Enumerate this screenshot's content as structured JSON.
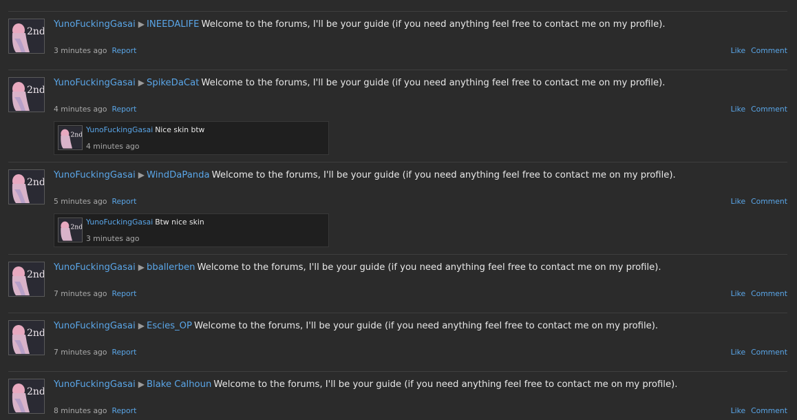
{
  "posts": [
    {
      "author": "YunoFuckingGasai",
      "target": "INEEDALIFE",
      "message": "Welcome to the forums, I'll be your guide (if you need anything feel free to contact me on my profile).",
      "time": "3 minutes ago",
      "report": "Report",
      "like": "Like",
      "comment": "Comment"
    },
    {
      "author": "YunoFuckingGasai",
      "target": "SpikeDaCat",
      "message": "Welcome to the forums, I'll be your guide (if you need anything feel free to contact me on my profile).",
      "time": "4 minutes ago",
      "report": "Report",
      "like": "Like",
      "comment": "Comment",
      "reply": {
        "author": "YunoFuckingGasai",
        "text": "Nice skin btw",
        "time": "4 minutes ago"
      }
    },
    {
      "author": "YunoFuckingGasai",
      "target": "WindDaPanda",
      "message": "Welcome to the forums, I'll be your guide (if you need anything feel free to contact me on my profile).",
      "time": "5 minutes ago",
      "report": "Report",
      "like": "Like",
      "comment": "Comment",
      "reply": {
        "author": "YunoFuckingGasai",
        "text": "Btw nice skin",
        "time": "3 minutes ago"
      }
    },
    {
      "author": "YunoFuckingGasai",
      "target": "bballerben",
      "message": "Welcome to the forums, I'll be your guide (if you need anything feel free to contact me on my profile).",
      "time": "7 minutes ago",
      "report": "Report",
      "like": "Like",
      "comment": "Comment"
    },
    {
      "author": "YunoFuckingGasai",
      "target": "Escies_OP",
      "message": "Welcome to the forums, I'll be your guide (if you need anything feel free to contact me on my profile).",
      "time": "7 minutes ago",
      "report": "Report",
      "like": "Like",
      "comment": "Comment"
    },
    {
      "author": "YunoFuckingGasai",
      "target": "Blake Calhoun",
      "message": "Welcome to the forums, I'll be your guide (if you need anything feel free to contact me on my profile).",
      "time": "8 minutes ago",
      "report": "Report",
      "like": "Like",
      "comment": "Comment"
    }
  ],
  "arrow_glyph": "▶",
  "avatar_badge": "2nd",
  "colors": {
    "background": "#2b2b2b",
    "link": "#5aa6e8",
    "text": "#e8e8e8",
    "muted": "#aaaaaa",
    "comment_bg": "#1f1f1f",
    "separator": "#3f3f3f"
  }
}
